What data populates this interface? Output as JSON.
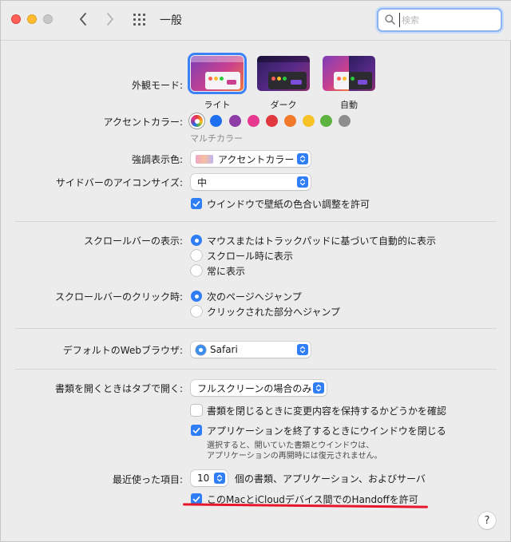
{
  "toolbar": {
    "title": "一般",
    "search_placeholder": "検索"
  },
  "appearance": {
    "label": "外観モード:",
    "options": [
      {
        "name": "ライト",
        "selected": true
      },
      {
        "name": "ダーク",
        "selected": false
      },
      {
        "name": "自動",
        "selected": false
      }
    ]
  },
  "accent": {
    "label": "アクセントカラー:",
    "colors": [
      "multicolor",
      "#1e6ff0",
      "#8e3da6",
      "#e6388e",
      "#e1383f",
      "#f2792a",
      "#f6c228",
      "#5cb340",
      "#8e8e8e"
    ],
    "selected_name": "マルチカラー"
  },
  "highlight": {
    "label": "強調表示色:",
    "value": "アクセントカラー"
  },
  "sidebar_icon": {
    "label": "サイドバーのアイコンサイズ:",
    "value": "中"
  },
  "wallpaper_tint": {
    "label": "ウインドウで壁紙の色合い調整を許可",
    "checked": true
  },
  "scrollbar_show": {
    "label": "スクロールバーの表示:",
    "options": [
      {
        "text": "マウスまたはトラックパッドに基づいて自動的に表示",
        "selected": true
      },
      {
        "text": "スクロール時に表示",
        "selected": false
      },
      {
        "text": "常に表示",
        "selected": false
      }
    ]
  },
  "scrollbar_click": {
    "label": "スクロールバーのクリック時:",
    "options": [
      {
        "text": "次のページへジャンプ",
        "selected": true
      },
      {
        "text": "クリックされた部分へジャンプ",
        "selected": false
      }
    ]
  },
  "browser": {
    "label": "デフォルトのWebブラウザ:",
    "value": "Safari"
  },
  "tabs": {
    "label": "書類を開くときはタブで開く:",
    "value": "フルスクリーンの場合のみ"
  },
  "ask_keep": {
    "label": "書類を閉じるときに変更内容を保持するかどうかを確認",
    "checked": false
  },
  "close_windows": {
    "label": "アプリケーションを終了するときにウインドウを閉じる",
    "checked": true,
    "note_line1": "選択すると、開いていた書類とウインドウは、",
    "note_line2": "アプリケーションの再開時には復元されません。"
  },
  "recent": {
    "label": "最近使った項目:",
    "value": "10",
    "suffix": "個の書類、アプリケーション、およびサーバ"
  },
  "handoff": {
    "label": "このMacとiCloudデバイス間でのHandoffを許可",
    "checked": true
  },
  "help": "?"
}
